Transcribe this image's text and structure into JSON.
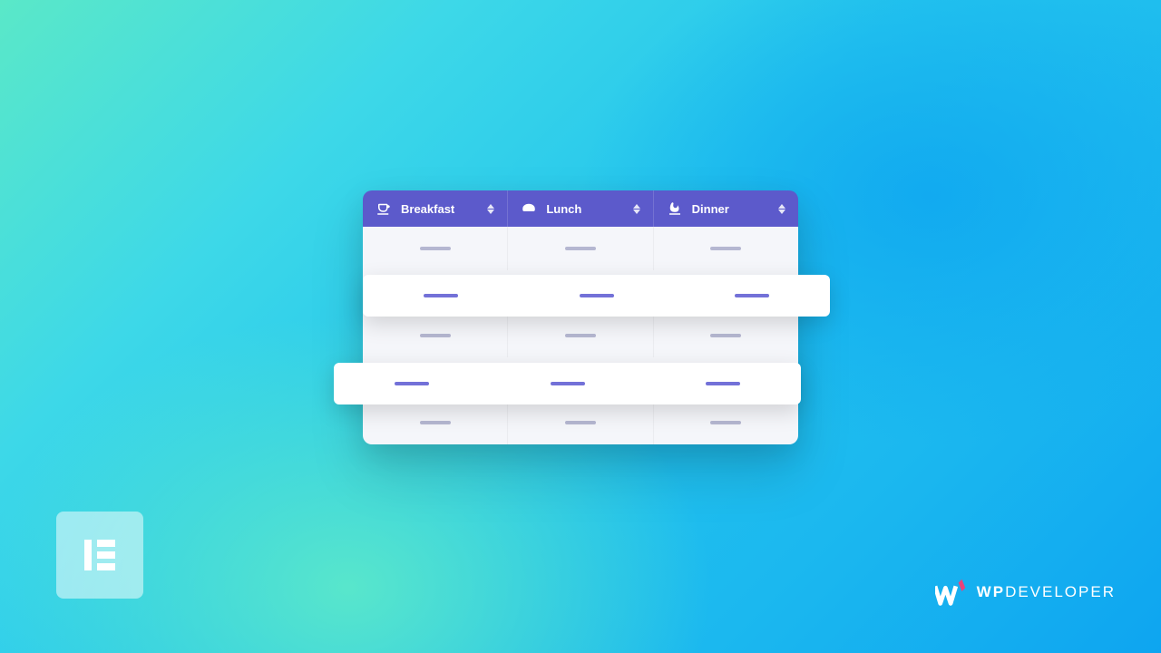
{
  "table": {
    "columns": [
      {
        "label": "Breakfast",
        "icon": "breakfast-icon"
      },
      {
        "label": "Lunch",
        "icon": "lunch-icon"
      },
      {
        "label": "Dinner",
        "icon": "dinner-icon"
      }
    ],
    "rows": [
      {
        "type": "dim"
      },
      {
        "type": "highlight"
      },
      {
        "type": "dim"
      },
      {
        "type": "highlight"
      },
      {
        "type": "dim"
      }
    ]
  },
  "logos": {
    "elementor": "Elementor",
    "wpdeveloper_prefix": "WP",
    "wpdeveloper_suffix": "DEVELOPER"
  }
}
